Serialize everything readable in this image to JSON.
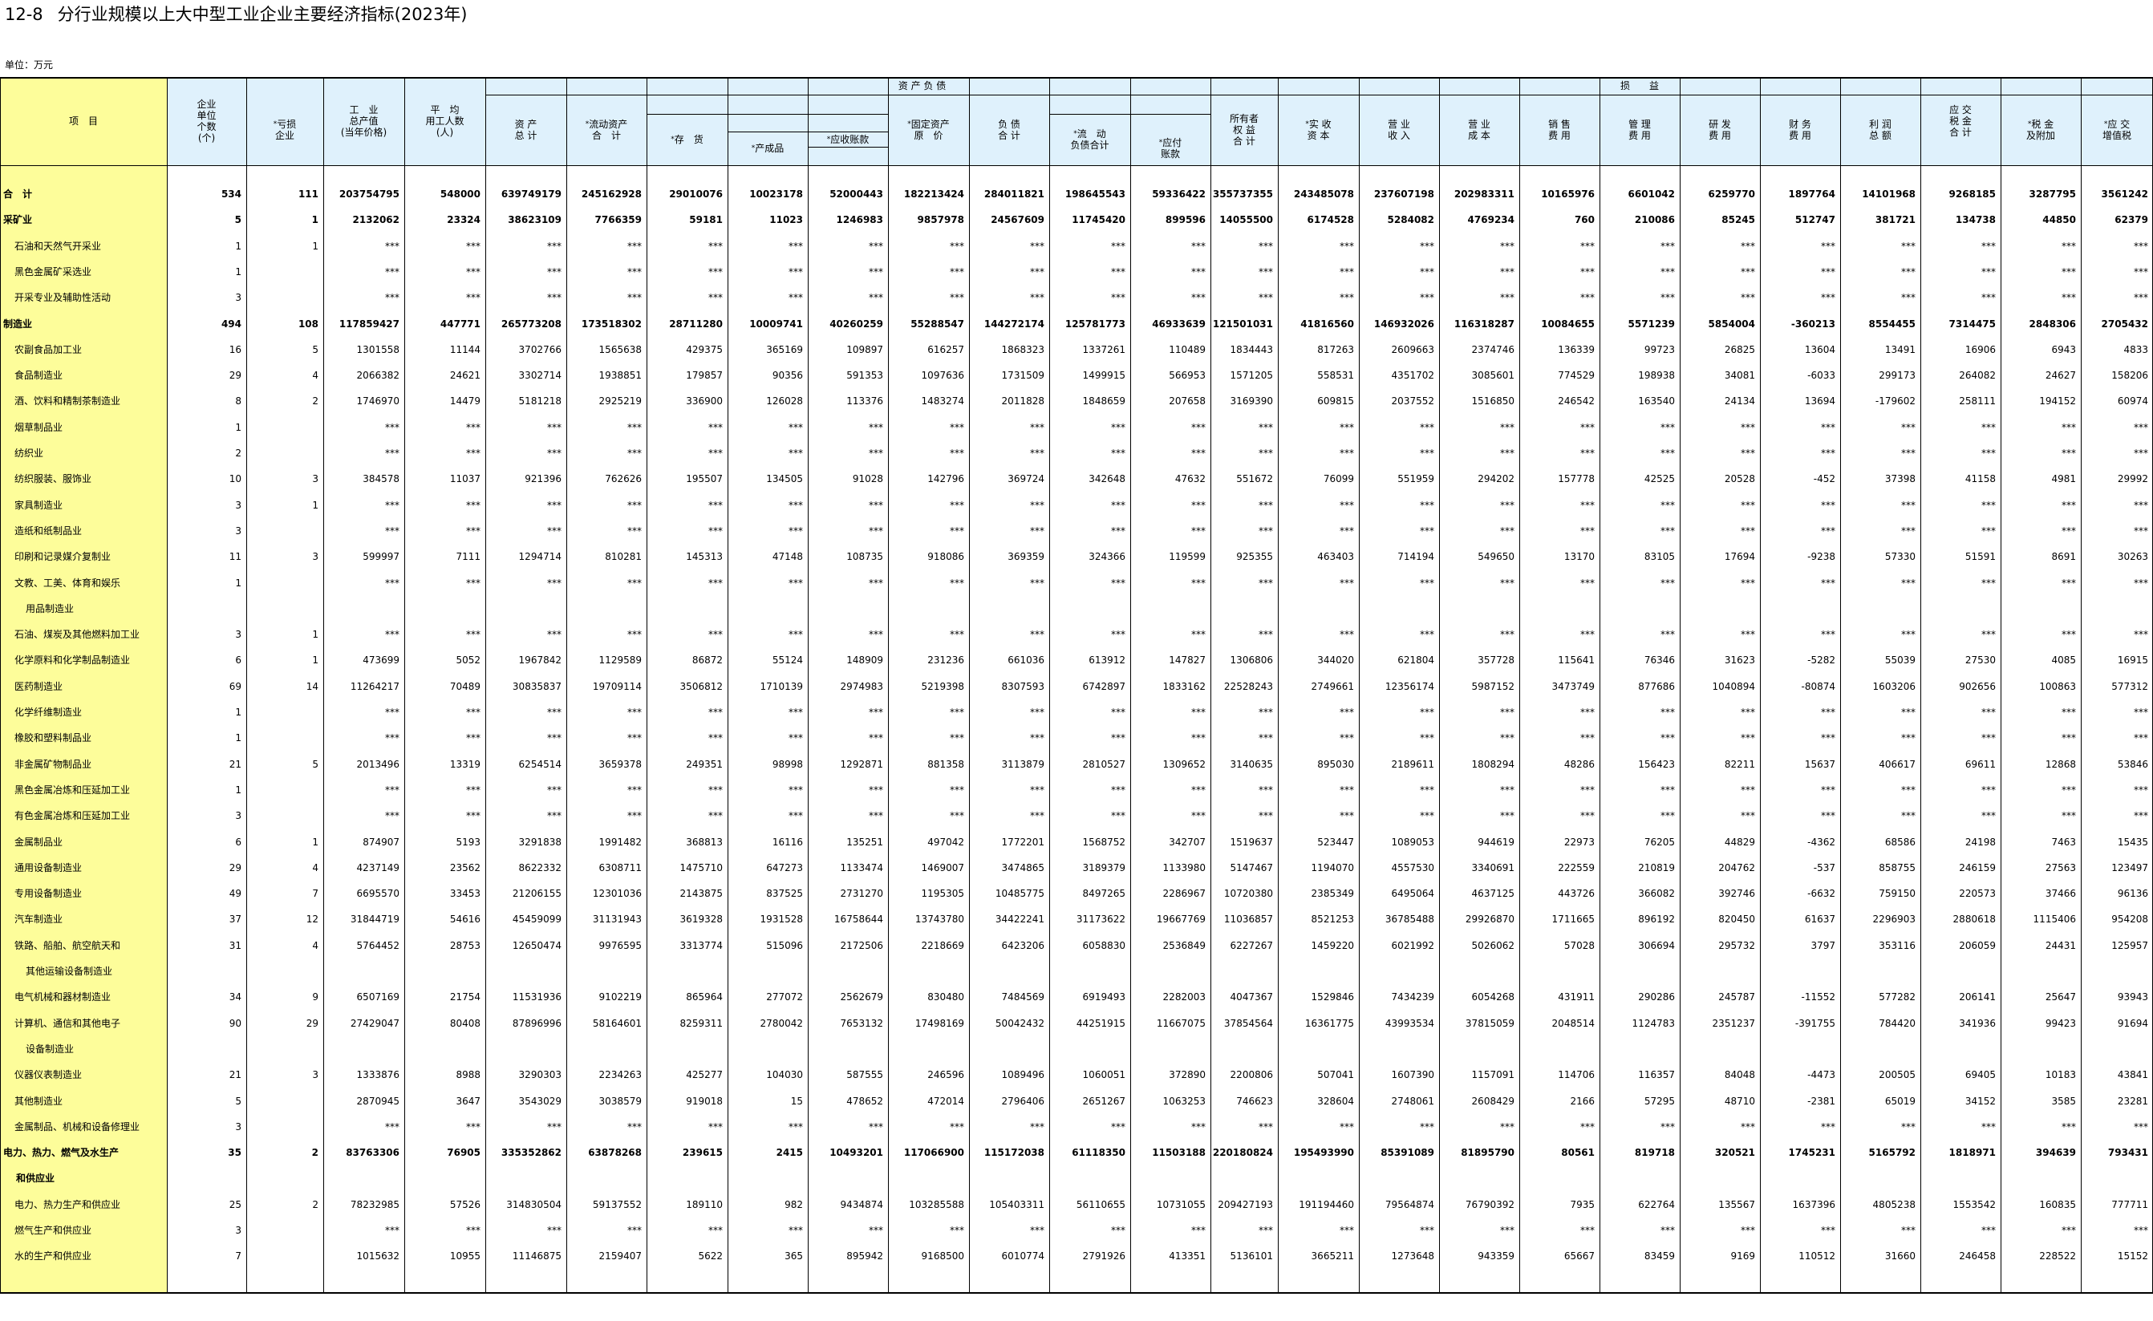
{
  "title": {
    "number": "12-8",
    "text": "分行业规模以上大中型工业企业主要经济指标(2023年)"
  },
  "unit": "单位：万元",
  "colors": {
    "item_column_bg": "#fdfd9a",
    "header_bg": "#dff1fc",
    "line": "#000000"
  },
  "header": {
    "item": "项　目",
    "units_count": "企业\n单位\n个数\n(个)",
    "loss_making": "亏损\n企业",
    "output_value": "工　业\n总产值\n(当年价格)",
    "avg_employees": "平　均\n用工人数\n(人)",
    "assets_group": "资 产 负 债",
    "total_assets": "资 产\n总 计",
    "current_assets": "流动资产\n合　计",
    "inventory": "存　货",
    "finished_goods": "产成品",
    "receivables": "应收账款",
    "fixed_assets": "固定资产\n原　价",
    "liabilities": "负 债\n合 计",
    "current_liabilities": "流　动\n负债合计",
    "payables": "应付\n账款",
    "owners_equity": "所有者\n权 益\n合 计",
    "paid_in_capital": "实 收\n资 本",
    "profit_loss_group": "损　　益",
    "revenue": "营 业\n收 入",
    "cost": "营 业\n成 本",
    "selling_expense": "销 售\n费 用",
    "admin_expense": "管 理\n费 用",
    "rd_expense": "研 发\n费 用",
    "finance_expense": "财 务\n费 用",
    "total_profit": "利 润\n总 额",
    "taxes_payable": "应 交\n税 金\n合 计",
    "taxes_surcharges": "税 金\n及附加",
    "vat_payable": "应 交\n增值税"
  },
  "rows": [
    {
      "name": "合　计",
      "bold": true,
      "values": [
        "534",
        "111",
        "203754795",
        "548000",
        "639749179",
        "245162928",
        "29010076",
        "10023178",
        "52000443",
        "182213424",
        "284011821",
        "198645543",
        "59336422",
        "355737355",
        "243485078",
        "237607198",
        "202983311",
        "10165976",
        "6601042",
        "6259770",
        "1897764",
        "14101968",
        "9268185",
        "3287795",
        "3561242"
      ]
    },
    {
      "name": "采矿业",
      "bold": true,
      "values": [
        "5",
        "1",
        "2132062",
        "23324",
        "38623109",
        "7766359",
        "59181",
        "11023",
        "1246983",
        "9857978",
        "24567609",
        "11745420",
        "899596",
        "14055500",
        "6174528",
        "5284082",
        "4769234",
        "760",
        "210086",
        "85245",
        "512747",
        "381721",
        "134738",
        "44850",
        "62379"
      ]
    },
    {
      "name": "石油和天然气开采业",
      "values": [
        "1",
        "1",
        "***",
        "***",
        "***",
        "***",
        "***",
        "***",
        "***",
        "***",
        "***",
        "***",
        "***",
        "***",
        "***",
        "***",
        "***",
        "***",
        "***",
        "***",
        "***",
        "***",
        "***",
        "***",
        "***"
      ]
    },
    {
      "name": "黑色金属矿采选业",
      "values": [
        "1",
        "",
        "***",
        "***",
        "***",
        "***",
        "***",
        "***",
        "***",
        "***",
        "***",
        "***",
        "***",
        "***",
        "***",
        "***",
        "***",
        "***",
        "***",
        "***",
        "***",
        "***",
        "***",
        "***",
        "***"
      ]
    },
    {
      "name": "开采专业及辅助性活动",
      "values": [
        "3",
        "",
        "***",
        "***",
        "***",
        "***",
        "***",
        "***",
        "***",
        "***",
        "***",
        "***",
        "***",
        "***",
        "***",
        "***",
        "***",
        "***",
        "***",
        "***",
        "***",
        "***",
        "***",
        "***",
        "***"
      ]
    },
    {
      "name": "制造业",
      "bold": true,
      "values": [
        "494",
        "108",
        "117859427",
        "447771",
        "265773208",
        "173518302",
        "28711280",
        "10009741",
        "40260259",
        "55288547",
        "144272174",
        "125781773",
        "46933639",
        "121501031",
        "41816560",
        "146932026",
        "116318287",
        "10084655",
        "5571239",
        "5854004",
        "-360213",
        "8554455",
        "7314475",
        "2848306",
        "2705432"
      ]
    },
    {
      "name": "农副食品加工业",
      "values": [
        "16",
        "5",
        "1301558",
        "11144",
        "3702766",
        "1565638",
        "429375",
        "365169",
        "109897",
        "616257",
        "1868323",
        "1337261",
        "110489",
        "1834443",
        "817263",
        "2609663",
        "2374746",
        "136339",
        "99723",
        "26825",
        "13604",
        "13491",
        "16906",
        "6943",
        "4833"
      ]
    },
    {
      "name": "食品制造业",
      "values": [
        "29",
        "4",
        "2066382",
        "24621",
        "3302714",
        "1938851",
        "179857",
        "90356",
        "591353",
        "1097636",
        "1731509",
        "1499915",
        "566953",
        "1571205",
        "558531",
        "4351702",
        "3085601",
        "774529",
        "198938",
        "34081",
        "-6033",
        "299173",
        "264082",
        "24627",
        "158206"
      ]
    },
    {
      "name": "酒、饮料和精制茶制造业",
      "values": [
        "8",
        "2",
        "1746970",
        "14479",
        "5181218",
        "2925219",
        "336900",
        "126028",
        "113376",
        "1483274",
        "2011828",
        "1848659",
        "207658",
        "3169390",
        "609815",
        "2037552",
        "1516850",
        "246542",
        "163540",
        "24134",
        "13694",
        "-179602",
        "258111",
        "194152",
        "60974"
      ]
    },
    {
      "name": "烟草制品业",
      "values": [
        "1",
        "",
        "***",
        "***",
        "***",
        "***",
        "***",
        "***",
        "***",
        "***",
        "***",
        "***",
        "***",
        "***",
        "***",
        "***",
        "***",
        "***",
        "***",
        "***",
        "***",
        "***",
        "***",
        "***",
        "***"
      ]
    },
    {
      "name": "纺织业",
      "values": [
        "2",
        "",
        "***",
        "***",
        "***",
        "***",
        "***",
        "***",
        "***",
        "***",
        "***",
        "***",
        "***",
        "***",
        "***",
        "***",
        "***",
        "***",
        "***",
        "***",
        "***",
        "***",
        "***",
        "***",
        "***"
      ]
    },
    {
      "name": "纺织服装、服饰业",
      "values": [
        "10",
        "3",
        "384578",
        "11037",
        "921396",
        "762626",
        "195507",
        "134505",
        "91028",
        "142796",
        "369724",
        "342648",
        "47632",
        "551672",
        "76099",
        "551959",
        "294202",
        "157778",
        "42525",
        "20528",
        "-452",
        "37398",
        "41158",
        "4981",
        "29992"
      ]
    },
    {
      "name": "家具制造业",
      "values": [
        "3",
        "1",
        "***",
        "***",
        "***",
        "***",
        "***",
        "***",
        "***",
        "***",
        "***",
        "***",
        "***",
        "***",
        "***",
        "***",
        "***",
        "***",
        "***",
        "***",
        "***",
        "***",
        "***",
        "***",
        "***"
      ]
    },
    {
      "name": "造纸和纸制品业",
      "values": [
        "3",
        "",
        "***",
        "***",
        "***",
        "***",
        "***",
        "***",
        "***",
        "***",
        "***",
        "***",
        "***",
        "***",
        "***",
        "***",
        "***",
        "***",
        "***",
        "***",
        "***",
        "***",
        "***",
        "***",
        "***"
      ]
    },
    {
      "name": "印刷和记录媒介复制业",
      "values": [
        "11",
        "3",
        "599997",
        "7111",
        "1294714",
        "810281",
        "145313",
        "47148",
        "108735",
        "918086",
        "369359",
        "324366",
        "119599",
        "925355",
        "463403",
        "714194",
        "549650",
        "13170",
        "83105",
        "17694",
        "-9238",
        "57330",
        "51591",
        "8691",
        "30263"
      ]
    },
    {
      "name": "文教、工美、体育和娱乐",
      "name2": "用品制造业",
      "values": [
        "1",
        "",
        "***",
        "***",
        "***",
        "***",
        "***",
        "***",
        "***",
        "***",
        "***",
        "***",
        "***",
        "***",
        "***",
        "***",
        "***",
        "***",
        "***",
        "***",
        "***",
        "***",
        "***",
        "***",
        "***"
      ]
    },
    {
      "name": "石油、煤炭及其他燃料加工业",
      "values": [
        "3",
        "1",
        "***",
        "***",
        "***",
        "***",
        "***",
        "***",
        "***",
        "***",
        "***",
        "***",
        "***",
        "***",
        "***",
        "***",
        "***",
        "***",
        "***",
        "***",
        "***",
        "***",
        "***",
        "***",
        "***"
      ]
    },
    {
      "name": "化学原料和化学制品制造业",
      "values": [
        "6",
        "1",
        "473699",
        "5052",
        "1967842",
        "1129589",
        "86872",
        "55124",
        "148909",
        "231236",
        "661036",
        "613912",
        "147827",
        "1306806",
        "344020",
        "621804",
        "357728",
        "115641",
        "76346",
        "31623",
        "-5282",
        "55039",
        "27530",
        "4085",
        "16915"
      ]
    },
    {
      "name": "医药制造业",
      "values": [
        "69",
        "14",
        "11264217",
        "70489",
        "30835837",
        "19709114",
        "3506812",
        "1710139",
        "2974983",
        "5219398",
        "8307593",
        "6742897",
        "1833162",
        "22528243",
        "2749661",
        "12356174",
        "5987152",
        "3473749",
        "877686",
        "1040894",
        "-80874",
        "1603206",
        "902656",
        "100863",
        "577312"
      ]
    },
    {
      "name": "化学纤维制造业",
      "values": [
        "1",
        "",
        "***",
        "***",
        "***",
        "***",
        "***",
        "***",
        "***",
        "***",
        "***",
        "***",
        "***",
        "***",
        "***",
        "***",
        "***",
        "***",
        "***",
        "***",
        "***",
        "***",
        "***",
        "***",
        "***"
      ]
    },
    {
      "name": "橡胶和塑料制品业",
      "values": [
        "1",
        "",
        "***",
        "***",
        "***",
        "***",
        "***",
        "***",
        "***",
        "***",
        "***",
        "***",
        "***",
        "***",
        "***",
        "***",
        "***",
        "***",
        "***",
        "***",
        "***",
        "***",
        "***",
        "***",
        "***"
      ]
    },
    {
      "name": "非金属矿物制品业",
      "values": [
        "21",
        "5",
        "2013496",
        "13319",
        "6254514",
        "3659378",
        "249351",
        "98998",
        "1292871",
        "881358",
        "3113879",
        "2810527",
        "1309652",
        "3140635",
        "895030",
        "2189611",
        "1808294",
        "48286",
        "156423",
        "82211",
        "15637",
        "406617",
        "69611",
        "12868",
        "53846"
      ]
    },
    {
      "name": "黑色金属冶炼和压延加工业",
      "values": [
        "1",
        "",
        "***",
        "***",
        "***",
        "***",
        "***",
        "***",
        "***",
        "***",
        "***",
        "***",
        "***",
        "***",
        "***",
        "***",
        "***",
        "***",
        "***",
        "***",
        "***",
        "***",
        "***",
        "***",
        "***"
      ]
    },
    {
      "name": "有色金属冶炼和压延加工业",
      "values": [
        "3",
        "",
        "***",
        "***",
        "***",
        "***",
        "***",
        "***",
        "***",
        "***",
        "***",
        "***",
        "***",
        "***",
        "***",
        "***",
        "***",
        "***",
        "***",
        "***",
        "***",
        "***",
        "***",
        "***",
        "***"
      ]
    },
    {
      "name": "金属制品业",
      "values": [
        "6",
        "1",
        "874907",
        "5193",
        "3291838",
        "1991482",
        "368813",
        "16116",
        "135251",
        "497042",
        "1772201",
        "1568752",
        "342707",
        "1519637",
        "523447",
        "1089053",
        "944619",
        "22973",
        "76205",
        "44829",
        "-4362",
        "68586",
        "24198",
        "7463",
        "15435"
      ]
    },
    {
      "name": "通用设备制造业",
      "values": [
        "29",
        "4",
        "4237149",
        "23562",
        "8622332",
        "6308711",
        "1475710",
        "647273",
        "1133474",
        "1469007",
        "3474865",
        "3189379",
        "1133980",
        "5147467",
        "1194070",
        "4557530",
        "3340691",
        "222559",
        "210819",
        "204762",
        "-537",
        "858755",
        "246159",
        "27563",
        "123497"
      ]
    },
    {
      "name": "专用设备制造业",
      "values": [
        "49",
        "7",
        "6695570",
        "33453",
        "21206155",
        "12301036",
        "2143875",
        "837525",
        "2731270",
        "1195305",
        "10485775",
        "8497265",
        "2286967",
        "10720380",
        "2385349",
        "6495064",
        "4637125",
        "443726",
        "366082",
        "392746",
        "-6632",
        "759150",
        "220573",
        "37466",
        "96136"
      ]
    },
    {
      "name": "汽车制造业",
      "values": [
        "37",
        "12",
        "31844719",
        "54616",
        "45459099",
        "31131943",
        "3619328",
        "1931528",
        "16758644",
        "13743780",
        "34422241",
        "31173622",
        "19667769",
        "11036857",
        "8521253",
        "36785488",
        "29926870",
        "1711665",
        "896192",
        "820450",
        "61637",
        "2296903",
        "2880618",
        "1115406",
        "954208"
      ]
    },
    {
      "name": "铁路、船舶、航空航天和",
      "name2": "其他运输设备制造业",
      "values": [
        "31",
        "4",
        "5764452",
        "28753",
        "12650474",
        "9976595",
        "3313774",
        "515096",
        "2172506",
        "2218669",
        "6423206",
        "6058830",
        "2536849",
        "6227267",
        "1459220",
        "6021992",
        "5026062",
        "57028",
        "306694",
        "295732",
        "3797",
        "353116",
        "206059",
        "24431",
        "125957"
      ]
    },
    {
      "name": "电气机械和器材制造业",
      "values": [
        "34",
        "9",
        "6507169",
        "21754",
        "11531936",
        "9102219",
        "865964",
        "277072",
        "2562679",
        "830480",
        "7484569",
        "6919493",
        "2282003",
        "4047367",
        "1529846",
        "7434239",
        "6054268",
        "431911",
        "290286",
        "245787",
        "-11552",
        "577282",
        "206141",
        "25647",
        "93943"
      ]
    },
    {
      "name": "计算机、通信和其他电子",
      "name2": "设备制造业",
      "values": [
        "90",
        "29",
        "27429047",
        "80408",
        "87896996",
        "58164601",
        "8259311",
        "2780042",
        "7653132",
        "17498169",
        "50042432",
        "44251915",
        "11667075",
        "37854564",
        "16361775",
        "43993534",
        "37815059",
        "2048514",
        "1124783",
        "2351237",
        "-391755",
        "784420",
        "341936",
        "99423",
        "91694"
      ]
    },
    {
      "name": "仪器仪表制造业",
      "values": [
        "21",
        "3",
        "1333876",
        "8988",
        "3290303",
        "2234263",
        "425277",
        "104030",
        "587555",
        "246596",
        "1089496",
        "1060051",
        "372890",
        "2200806",
        "507041",
        "1607390",
        "1157091",
        "114706",
        "116357",
        "84048",
        "-4473",
        "200505",
        "69405",
        "10183",
        "43841"
      ]
    },
    {
      "name": "其他制造业",
      "values": [
        "5",
        "",
        "2870945",
        "3647",
        "3543029",
        "3038579",
        "919018",
        "15",
        "478652",
        "472014",
        "2796406",
        "2651267",
        "1063253",
        "746623",
        "328604",
        "2748061",
        "2608429",
        "2166",
        "57295",
        "48710",
        "-2381",
        "65019",
        "34152",
        "3585",
        "23281"
      ]
    },
    {
      "name": "金属制品、机械和设备修理业",
      "values": [
        "3",
        "",
        "***",
        "***",
        "***",
        "***",
        "***",
        "***",
        "***",
        "***",
        "***",
        "***",
        "***",
        "***",
        "***",
        "***",
        "***",
        "***",
        "***",
        "***",
        "***",
        "***",
        "***",
        "***",
        "***"
      ]
    },
    {
      "name": "电力、热力、燃气及水生产",
      "name2": "和供应业",
      "bold": true,
      "values": [
        "35",
        "2",
        "83763306",
        "76905",
        "335352862",
        "63878268",
        "239615",
        "2415",
        "10493201",
        "117066900",
        "115172038",
        "61118350",
        "11503188",
        "220180824",
        "195493990",
        "85391089",
        "81895790",
        "80561",
        "819718",
        "320521",
        "1745231",
        "5165792",
        "1818971",
        "394639",
        "793431"
      ]
    },
    {
      "name": "电力、热力生产和供应业",
      "values": [
        "25",
        "2",
        "78232985",
        "57526",
        "314830504",
        "59137552",
        "189110",
        "982",
        "9434874",
        "103285588",
        "105403311",
        "56110655",
        "10731055",
        "209427193",
        "191194460",
        "79564874",
        "76790392",
        "7935",
        "622764",
        "135567",
        "1637396",
        "4805238",
        "1553542",
        "160835",
        "777711"
      ]
    },
    {
      "name": "燃气生产和供应业",
      "values": [
        "3",
        "",
        "***",
        "***",
        "***",
        "***",
        "***",
        "***",
        "***",
        "***",
        "***",
        "***",
        "***",
        "***",
        "***",
        "***",
        "***",
        "***",
        "***",
        "***",
        "***",
        "***",
        "***",
        "***",
        "***"
      ]
    },
    {
      "name": "水的生产和供应业",
      "values": [
        "7",
        "",
        "1015632",
        "10955",
        "11146875",
        "2159407",
        "5622",
        "365",
        "895942",
        "9168500",
        "6010774",
        "2791926",
        "413351",
        "5136101",
        "3665211",
        "1273648",
        "943359",
        "65667",
        "83459",
        "9169",
        "110512",
        "31660",
        "246458",
        "228522",
        "15152"
      ]
    }
  ]
}
